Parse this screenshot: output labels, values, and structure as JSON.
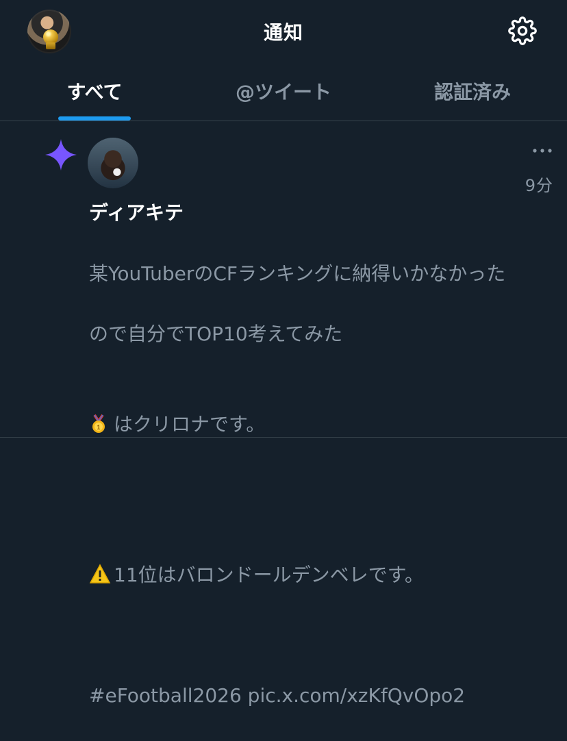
{
  "header": {
    "title": "通知",
    "avatar_icon": "user-avatar-icon",
    "settings_icon": "gear-icon"
  },
  "tabs": [
    {
      "label": "すべて",
      "active": true
    },
    {
      "label": "@ツイート",
      "active": false
    },
    {
      "label": "認証済み",
      "active": false
    }
  ],
  "notification": {
    "username": "ディアキテ",
    "time": "9分",
    "icons": {
      "type": "sparkle-icon",
      "more": "more-options-icon",
      "medal": "gold-medal-icon",
      "warning": "warning-icon"
    },
    "lines": [
      "某YouTuberのCFランキングに納得いかなかった",
      "ので自分でTOP10考えてみた",
      "はクリロナです。",
      "",
      "11位はバロンドールデンベレです。",
      "",
      "#eFootball2026 pic.x.com/xzKfQvOpo2"
    ]
  },
  "colors": {
    "background": "#15202b",
    "accent": "#1d9bf0",
    "secondary_text": "#8b98a5",
    "divider": "#38444d",
    "sparkle": "#7856ff"
  }
}
